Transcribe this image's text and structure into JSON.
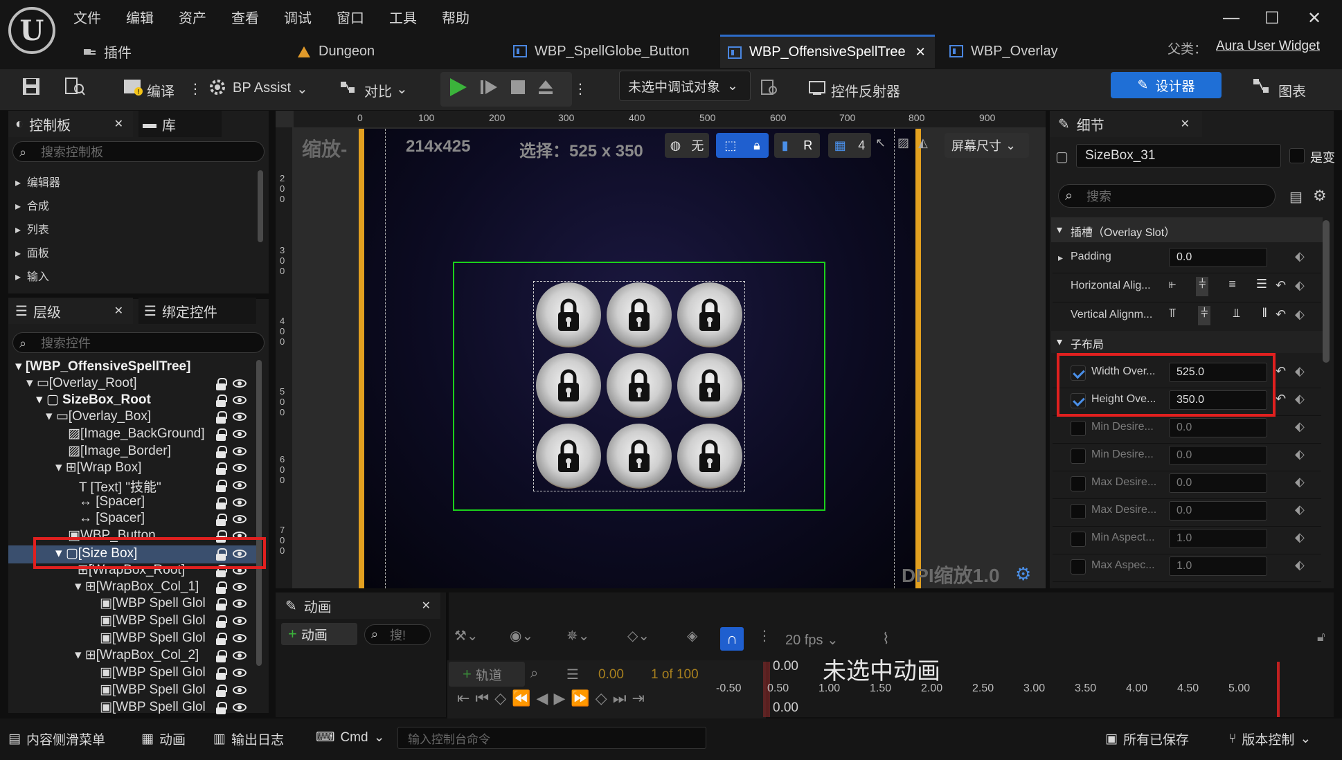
{
  "menu": [
    "文件",
    "编辑",
    "资产",
    "查看",
    "调试",
    "窗口",
    "工具",
    "帮助"
  ],
  "plugin_label": "插件",
  "tabs": [
    {
      "label": "Dungeon"
    },
    {
      "label": "WBP_SpellGlobe_Button"
    },
    {
      "label": "WBP_OffensiveSpellTree"
    },
    {
      "label": "WBP_Overlay"
    }
  ],
  "parent_label": "父类：",
  "parent_value": "Aura User Widget",
  "toolbar": {
    "compile": "编译",
    "bp_assist": "BP Assist",
    "diff": "对比",
    "debug_target": "未选中调试对象",
    "widget_reflector": "控件反射器",
    "designer": "设计器",
    "graph": "图表"
  },
  "palette": {
    "tab1": "控制板",
    "tab2": "库",
    "search_placeholder": "搜索控制板",
    "categories": [
      "编辑器",
      "合成",
      "列表",
      "面板",
      "输入"
    ]
  },
  "hierarchy": {
    "tab1": "层级",
    "tab2": "绑定控件",
    "search_placeholder": "搜索控件",
    "items": [
      "[WBP_OffensiveSpellTree]",
      "[Overlay_Root]",
      "SizeBox_Root",
      "[Overlay_Box]",
      "[Image_BackGround]",
      "[Image_Border]",
      "[Wrap Box]",
      "[Text] \"技能\"",
      "[Spacer]",
      "[Spacer]",
      "WBP_Button",
      "[Size Box]",
      "[WrapBox_Root]",
      "[WrapBox_Col_1]",
      "[WBP Spell Glol",
      "[WBP Spell Glol",
      "[WBP Spell Glol",
      "[WrapBox_Col_2]",
      "[WBP Spell Glol",
      "[WBP Spell Glol",
      "[WBP Spell Glol"
    ]
  },
  "viewport": {
    "zoom_label": "缩放-",
    "size_readout": "214x425",
    "selection_readout": "选择：525 x 350",
    "none_label": "无",
    "r_label": "R",
    "grid_count": "4",
    "screen_size": "屏幕尺寸",
    "dpi": "DPI缩放1.0",
    "ruler_x": [
      "0",
      "100",
      "200",
      "300",
      "400",
      "500",
      "600",
      "700",
      "800",
      "900"
    ],
    "ruler_y": [
      "200",
      "300",
      "400",
      "500",
      "600",
      "700"
    ]
  },
  "details": {
    "title": "细节",
    "name_value": "SizeBox_31",
    "is_variable": "是变",
    "search_placeholder": "搜索",
    "slot_section": "插槽（Overlay Slot）",
    "padding_label": "Padding",
    "padding_value": "0.0",
    "halign_label": "Horizontal Alig...",
    "valign_label": "Vertical Alignm...",
    "child_layout": "子布局",
    "props": [
      {
        "label": "Width Over...",
        "value": "525.0",
        "checked": true
      },
      {
        "label": "Height Ove...",
        "value": "350.0",
        "checked": true
      },
      {
        "label": "Min Desire...",
        "value": "0.0",
        "checked": false
      },
      {
        "label": "Min Desire...",
        "value": "0.0",
        "checked": false
      },
      {
        "label": "Max Desire...",
        "value": "0.0",
        "checked": false
      },
      {
        "label": "Max Desire...",
        "value": "0.0",
        "checked": false
      },
      {
        "label": "Min Aspect...",
        "value": "1.0",
        "checked": false
      },
      {
        "label": "Max Aspec...",
        "value": "1.0",
        "checked": false
      }
    ]
  },
  "animation": {
    "title": "动画",
    "add_label": "动画",
    "search_placeholder": "搜!",
    "fps": "20 fps",
    "track_label": "轨道",
    "time_value": "0.00",
    "frame_readout": "1 of 100",
    "no_anim": "未选中动画",
    "value_top": "0.00",
    "value_bottom": "0.00",
    "ticks": [
      "-0.50",
      "0.50",
      "1.00",
      "1.50",
      "2.00",
      "2.50",
      "3.00",
      "3.50",
      "4.00",
      "4.50",
      "5.00"
    ]
  },
  "statusbar": {
    "content_drawer": "内容侧滑菜单",
    "animation": "动画",
    "output_log": "输出日志",
    "cmd": "Cmd",
    "console_placeholder": "输入控制台命令",
    "all_saved": "所有已保存",
    "source_control": "版本控制"
  },
  "colors": {
    "accent_blue": "#2d6bc9",
    "highlight_red": "#e0201f",
    "selection_green": "#1bd11b",
    "play_green": "#3bb33b"
  }
}
